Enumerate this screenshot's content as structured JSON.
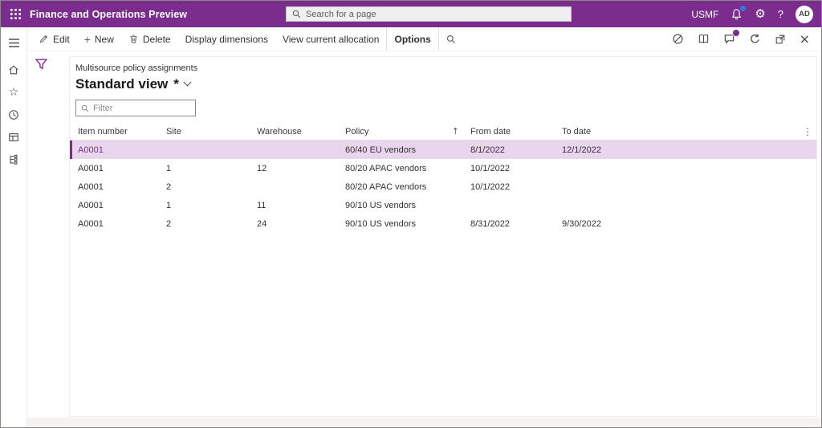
{
  "colors": {
    "accent": "#7b2d8e",
    "selected_row_bg": "#e9d6ee",
    "notification_badge": "#2d7dd2"
  },
  "app_bar": {
    "title": "Finance and Operations Preview",
    "search_placeholder": "Search for a page",
    "company": "USMF",
    "help_label": "?",
    "avatar_initials": "AD"
  },
  "action_pane": {
    "edit": "Edit",
    "new": "New",
    "delete": "Delete",
    "display_dimensions": "Display dimensions",
    "view_current_allocation": "View current allocation",
    "options": "Options"
  },
  "page": {
    "caption": "Multisource policy assignments",
    "view_title": "Standard view",
    "modified_marker": "*",
    "filter_placeholder": "Filter"
  },
  "grid": {
    "columns": {
      "item_number": "Item number",
      "site": "Site",
      "warehouse": "Warehouse",
      "policy": "Policy",
      "from_date": "From date",
      "to_date": "To date"
    },
    "sort": {
      "column": "Policy",
      "direction": "ascending",
      "indicator": "↑"
    },
    "rows": [
      {
        "item_number": "A0001",
        "site": "",
        "warehouse": "",
        "policy": "60/40 EU vendors",
        "from_date": "8/1/2022",
        "to_date": "12/1/2022",
        "selected": true
      },
      {
        "item_number": "A0001",
        "site": "1",
        "warehouse": "12",
        "policy": "80/20 APAC vendors",
        "from_date": "10/1/2022",
        "to_date": "",
        "selected": false
      },
      {
        "item_number": "A0001",
        "site": "2",
        "warehouse": "",
        "policy": "80/20 APAC vendors",
        "from_date": "10/1/2022",
        "to_date": "",
        "selected": false
      },
      {
        "item_number": "A0001",
        "site": "1",
        "warehouse": "11",
        "policy": "90/10 US vendors",
        "from_date": "",
        "to_date": "",
        "selected": false
      },
      {
        "item_number": "A0001",
        "site": "2",
        "warehouse": "24",
        "policy": "90/10 US vendors",
        "from_date": "8/31/2022",
        "to_date": "9/30/2022",
        "selected": false
      }
    ]
  },
  "icons": {
    "kebab": "⋮",
    "gear": "⚙",
    "star": "☆",
    "close": "×",
    "plus": "+"
  }
}
